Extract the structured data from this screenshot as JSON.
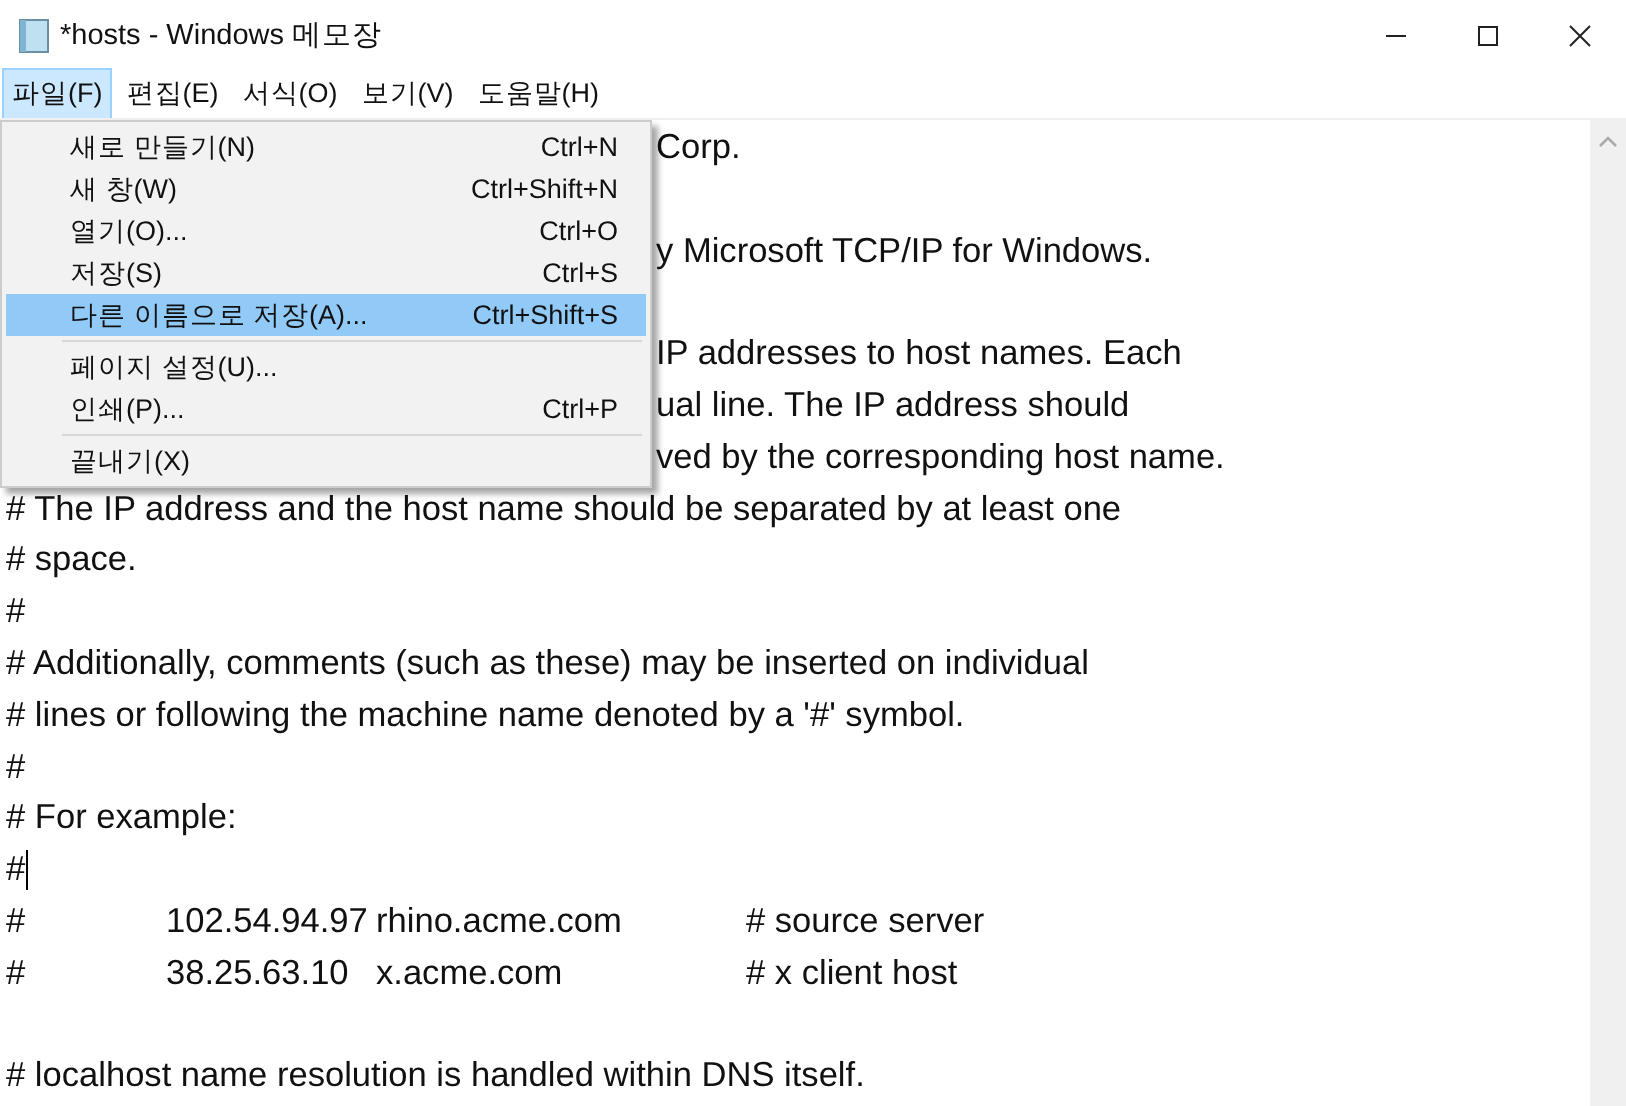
{
  "window": {
    "title": "*hosts - Windows 메모장"
  },
  "menu_bar": [
    {
      "label": "파일(F)",
      "selected": true
    },
    {
      "label": "편집(E)",
      "selected": false
    },
    {
      "label": "서식(O)",
      "selected": false
    },
    {
      "label": "보기(V)",
      "selected": false
    },
    {
      "label": "도움말(H)",
      "selected": false
    }
  ],
  "file_menu": [
    {
      "kind": "item",
      "label": "새로 만들기(N)",
      "shortcut": "Ctrl+N",
      "selected": false
    },
    {
      "kind": "item",
      "label": "새 창(W)",
      "shortcut": "Ctrl+Shift+N",
      "selected": false
    },
    {
      "kind": "item",
      "label": "열기(O)...",
      "shortcut": "Ctrl+O",
      "selected": false
    },
    {
      "kind": "item",
      "label": "저장(S)",
      "shortcut": "Ctrl+S",
      "selected": false
    },
    {
      "kind": "item",
      "label": "다른 이름으로 저장(A)...",
      "shortcut": "Ctrl+Shift+S",
      "selected": true
    },
    {
      "kind": "separator"
    },
    {
      "kind": "item",
      "label": "페이지 설정(U)...",
      "selected": false
    },
    {
      "kind": "item",
      "label": "인쇄(P)...",
      "shortcut": "Ctrl+P",
      "selected": false
    },
    {
      "kind": "separator"
    },
    {
      "kind": "item",
      "label": "끝내기(X)",
      "selected": false
    }
  ],
  "editor": {
    "lines": [
      {
        "kind": "clipped",
        "text": "Corp."
      },
      {
        "kind": "hidden"
      },
      {
        "kind": "clipped",
        "text": "y Microsoft TCP/IP for Windows."
      },
      {
        "kind": "hidden"
      },
      {
        "kind": "clipped",
        "text": "IP addresses to host names. Each"
      },
      {
        "kind": "clipped",
        "text": "ual line. The IP address should"
      },
      {
        "kind": "clipped",
        "text": "ved by the corresponding host name."
      },
      {
        "kind": "text",
        "text": "# The IP address and the host name should be separated by at least one"
      },
      {
        "kind": "text",
        "text": "# space."
      },
      {
        "kind": "text",
        "text": "#"
      },
      {
        "kind": "text",
        "text": "# Additionally, comments (such as these) may be inserted on individual"
      },
      {
        "kind": "text",
        "text": "# lines or following the machine name denoted by a '#' symbol."
      },
      {
        "kind": "text",
        "text": "#"
      },
      {
        "kind": "text",
        "text": "# For example:"
      },
      {
        "kind": "text",
        "text": "#",
        "caret": true
      },
      {
        "kind": "columns",
        "cells": [
          "#",
          "102.54.94.97",
          "rhino.acme.com",
          "# source server"
        ]
      },
      {
        "kind": "columns",
        "cells": [
          "#",
          "38.25.63.10",
          "x.acme.com",
          "# x client host"
        ]
      },
      {
        "kind": "hidden"
      },
      {
        "kind": "text",
        "text": "# localhost name resolution is handled within DNS itself."
      }
    ]
  }
}
